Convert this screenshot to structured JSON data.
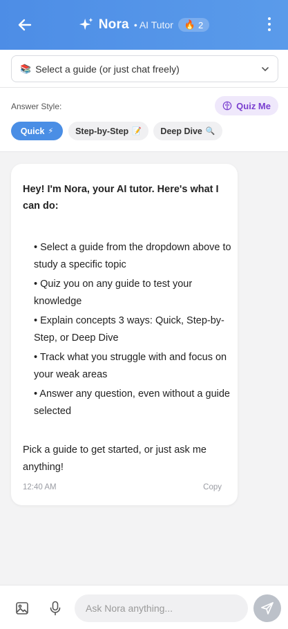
{
  "header": {
    "title": "Nora",
    "subtitle": "• AI Tutor",
    "streak_emoji": "🔥",
    "streak_count": "2",
    "accent_color": "#4d8de6"
  },
  "guide_select": {
    "emoji": "📚",
    "value": "Select a guide (or just chat freely)"
  },
  "answer_style": {
    "label": "Answer Style:",
    "quiz_label": "Quiz Me",
    "options": [
      {
        "label": "Quick",
        "emoji": "⚡",
        "active": true
      },
      {
        "label": "Step-by-Step",
        "emoji": "📝",
        "active": false
      },
      {
        "label": "Deep Dive",
        "emoji": "🔍",
        "active": false
      }
    ]
  },
  "message": {
    "intro": "Hey! I'm Nora, your AI tutor. Here's what I can do:",
    "bullets": [
      "• Select a guide from the dropdown above to study a specific topic",
      "• Quiz you on any guide to test your knowledge",
      "• Explain concepts 3 ways: Quick, Step-by-Step, or Deep Dive",
      "• Track what you struggle with and focus on your weak areas",
      "• Answer any question, even without a guide selected"
    ],
    "outro": "Pick a guide to get started, or just ask me anything!",
    "time": "12:40 AM",
    "copy_label": "Copy"
  },
  "composer": {
    "placeholder": "Ask Nora anything..."
  }
}
